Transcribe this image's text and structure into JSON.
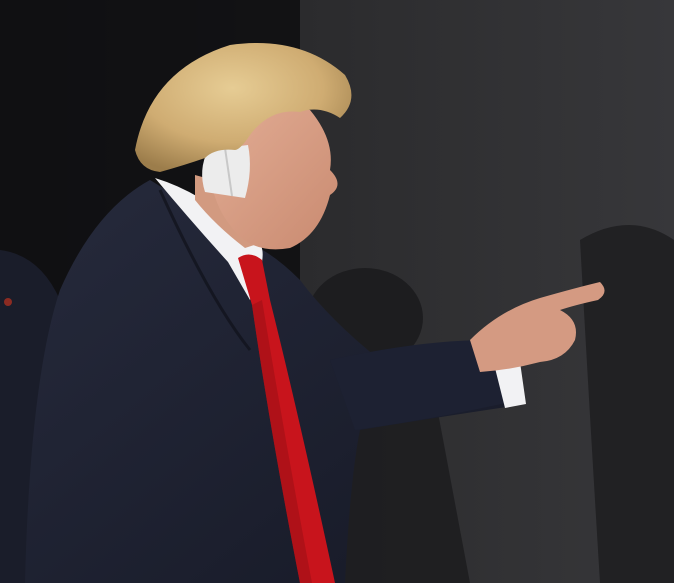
{
  "scene": {
    "type": "photograph",
    "colors": {
      "backdrop_dark": "#0f0f10",
      "backdrop_wall": "#2e2e30",
      "suit": "#1e2233",
      "shirt": "#f2f2f4",
      "tie": "#c8141c",
      "hair": "#d4b27a",
      "skin": "#d9a08a",
      "bandage": "#ececec"
    }
  }
}
